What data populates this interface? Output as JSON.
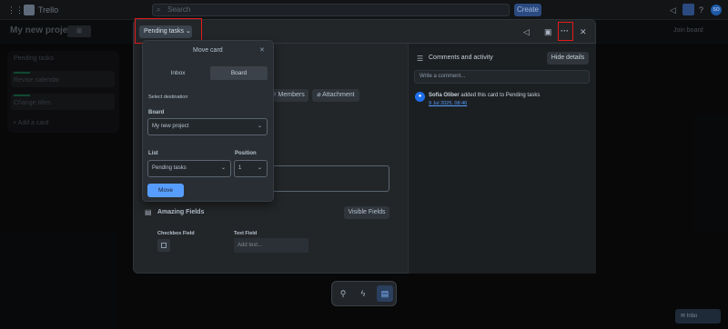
{
  "topbar": {
    "app_name": "Trello",
    "search_placeholder": "Search",
    "create_label": "Create",
    "icons": [
      "megaphone-icon",
      "bell-icon",
      "help-icon",
      "avatar"
    ],
    "avatar_initials": "SO"
  },
  "board": {
    "title": "My new project",
    "view_label": "⊞",
    "share_label": "Join board",
    "list": {
      "title": "Pending tasks",
      "cards": [
        "Revise calendar",
        "Change titles"
      ],
      "add_card": "Add a card"
    },
    "fab_label": "Inbo"
  },
  "modal": {
    "list_button": "Pending tasks",
    "header_icons": [
      "megaphone-icon",
      "cover-image-icon",
      "more-icon",
      "close-icon"
    ],
    "actions": {
      "members": "Members",
      "attachment": "Attachment"
    },
    "fields_section": {
      "title": "Amazing Fields",
      "visible_fields_button": "Visible Fields",
      "checkbox_label": "Checkbox Field",
      "text_label": "Text Field",
      "text_placeholder": "Add text..."
    },
    "comments": {
      "title": "Comments and activity",
      "hide_details": "Hide details",
      "input_placeholder": "Write a comment...",
      "activity_user": "Sofia Oliber",
      "activity_text": "added this card to Pending tasks",
      "activity_time": "9 Jul 2025, 08:46"
    }
  },
  "move_popover": {
    "title": "Move card",
    "tabs": [
      "Inbox",
      "Board"
    ],
    "select_destination": "Select destination",
    "board_label": "Board",
    "board_value": "My new project",
    "list_label": "List",
    "list_value": "Pending tasks",
    "position_label": "Position",
    "position_value": "1",
    "move_button": "Move"
  },
  "bottom_toolbar": {
    "icons": [
      "pin-icon",
      "lightning-icon",
      "board-icon"
    ]
  },
  "colors": {
    "accent": "#579dff",
    "highlight_box": "#e41b1b",
    "list_label_green": "#1f845a"
  }
}
